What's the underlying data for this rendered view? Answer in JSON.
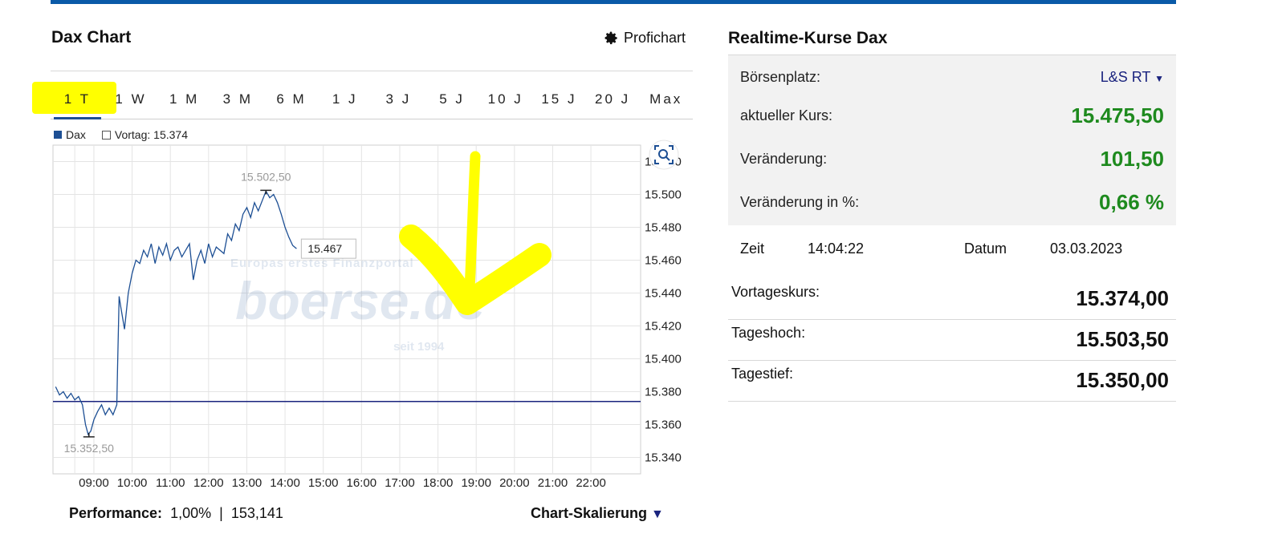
{
  "left_panel": {
    "title": "Dax Chart",
    "profichart_label": "Profichart",
    "tabs": [
      "1 T",
      "1 W",
      "1 M",
      "3 M",
      "6 M",
      "1 J",
      "3 J",
      "5 J",
      "10 J",
      "15 J",
      "20 J",
      "Max"
    ],
    "active_tab": "1 T",
    "legend": {
      "series": "Dax",
      "previous": "Vortag: 15.374"
    },
    "performance": {
      "label": "Performance:",
      "value": "1,00%",
      "separator": "|",
      "points": "153,141"
    },
    "scaling_label": "Chart-Skalierung",
    "watermark": {
      "tagline": "Europas erstes Finanzportal",
      "brand": "boerse.de",
      "since": "seit 1994"
    }
  },
  "chart_data": {
    "type": "line",
    "x_ticks": [
      "09:00",
      "10:00",
      "11:00",
      "12:00",
      "13:00",
      "14:00",
      "15:00",
      "16:00",
      "17:00",
      "18:00",
      "19:00",
      "20:00",
      "21:00",
      "22:00"
    ],
    "y_ticks": [
      "15.340",
      "15.360",
      "15.380",
      "15.400",
      "15.420",
      "15.440",
      "15.460",
      "15.480",
      "15.500",
      "15.520"
    ],
    "ylim": [
      15330,
      15530
    ],
    "xlim": [
      7.93,
      23.3
    ],
    "reference_line": 15374,
    "high_label": "15.502,50",
    "low_label": "15.352,50",
    "last_label": "15.467",
    "high_point": {
      "x": 13.5,
      "y": 15502.5
    },
    "low_point": {
      "x": 8.87,
      "y": 15352.5
    },
    "series": [
      {
        "name": "Dax",
        "points": [
          [
            8.0,
            15383
          ],
          [
            8.1,
            15378
          ],
          [
            8.2,
            15380
          ],
          [
            8.3,
            15376
          ],
          [
            8.4,
            15379
          ],
          [
            8.5,
            15375
          ],
          [
            8.6,
            15377
          ],
          [
            8.7,
            15372
          ],
          [
            8.78,
            15360
          ],
          [
            8.85,
            15354
          ],
          [
            8.92,
            15356
          ],
          [
            9.0,
            15363
          ],
          [
            9.1,
            15368
          ],
          [
            9.2,
            15372
          ],
          [
            9.3,
            15366
          ],
          [
            9.4,
            15370
          ],
          [
            9.5,
            15366
          ],
          [
            9.6,
            15372
          ],
          [
            9.62,
            15396
          ],
          [
            9.66,
            15438
          ],
          [
            9.7,
            15432
          ],
          [
            9.8,
            15418
          ],
          [
            9.9,
            15440
          ],
          [
            10.0,
            15452
          ],
          [
            10.1,
            15460
          ],
          [
            10.2,
            15458
          ],
          [
            10.3,
            15466
          ],
          [
            10.4,
            15462
          ],
          [
            10.5,
            15470
          ],
          [
            10.6,
            15458
          ],
          [
            10.7,
            15468
          ],
          [
            10.8,
            15463
          ],
          [
            10.9,
            15470
          ],
          [
            11.0,
            15460
          ],
          [
            11.1,
            15466
          ],
          [
            11.2,
            15468
          ],
          [
            11.3,
            15462
          ],
          [
            11.5,
            15470
          ],
          [
            11.6,
            15448
          ],
          [
            11.7,
            15460
          ],
          [
            11.8,
            15466
          ],
          [
            11.9,
            15458
          ],
          [
            12.0,
            15470
          ],
          [
            12.1,
            15462
          ],
          [
            12.2,
            15468
          ],
          [
            12.4,
            15464
          ],
          [
            12.5,
            15476
          ],
          [
            12.6,
            15472
          ],
          [
            12.7,
            15482
          ],
          [
            12.8,
            15478
          ],
          [
            12.9,
            15488
          ],
          [
            13.0,
            15492
          ],
          [
            13.1,
            15486
          ],
          [
            13.2,
            15495
          ],
          [
            13.3,
            15490
          ],
          [
            13.4,
            15496
          ],
          [
            13.5,
            15502
          ],
          [
            13.6,
            15498
          ],
          [
            13.7,
            15500
          ],
          [
            13.8,
            15495
          ],
          [
            13.9,
            15488
          ],
          [
            14.0,
            15480
          ],
          [
            14.1,
            15474
          ],
          [
            14.2,
            15469
          ],
          [
            14.3,
            15467
          ]
        ]
      }
    ]
  },
  "right_panel": {
    "title": "Realtime-Kurse Dax",
    "exchange": {
      "label": "Börsenplatz:",
      "value": "L&S RT"
    },
    "price": {
      "label": "aktueller Kurs:",
      "value": "15.475,50"
    },
    "change": {
      "label": "Veränderung:",
      "value": "101,50"
    },
    "change_pct": {
      "label": "Veränderung in %:",
      "value": "0,66 %"
    },
    "time": {
      "label": "Zeit",
      "value": "14:04:22"
    },
    "date": {
      "label": "Datum",
      "value": "03.03.2023"
    },
    "stats": [
      {
        "label": "Vortageskurs:",
        "value": "15.374,00"
      },
      {
        "label": "Tageshoch:",
        "value": "15.503,50"
      },
      {
        "label": "Tagestief:",
        "value": "15.350,00"
      }
    ]
  },
  "colors": {
    "accent": "#0a5aa8",
    "series": "#1d4f94",
    "reference": "#1a237e",
    "positive": "#1e8a1e",
    "highlight": "#ffff00"
  },
  "icons": {
    "profichart": "gear-icon",
    "chart_zoom": "magnifier-icon"
  }
}
